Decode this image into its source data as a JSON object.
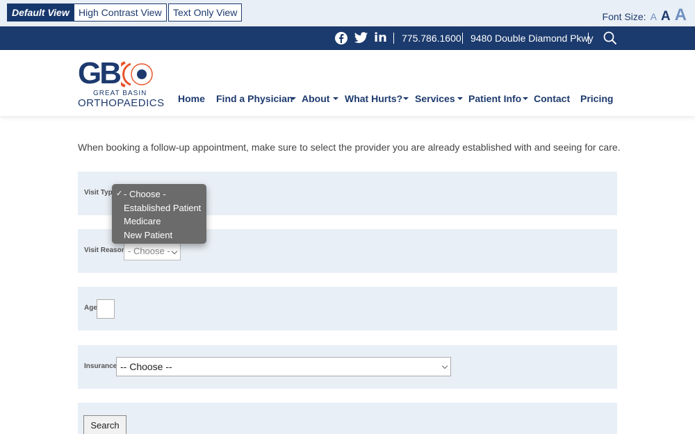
{
  "accessibility": {
    "views": [
      {
        "label": "Default View",
        "active": true
      },
      {
        "label": "High Contrast View",
        "active": false
      },
      {
        "label": "Text Only View",
        "active": false
      }
    ],
    "font_size_label": "Font Size:",
    "font_size_options": [
      "A",
      "A",
      "A"
    ]
  },
  "topbar": {
    "phone": "775.786.1600",
    "address": "9480 Double Diamond Pkwy",
    "social": [
      "facebook-icon",
      "twitter-icon",
      "linkedin-icon"
    ],
    "search_icon": "search-icon"
  },
  "logo": {
    "mark": "GB",
    "line1": "GREAT BASIN",
    "line2": "ORTHOPAEDICS"
  },
  "nav": {
    "items": [
      {
        "label": "Home",
        "has_dropdown": false
      },
      {
        "label": "Find a Physician",
        "has_dropdown": true
      },
      {
        "label": "About",
        "has_dropdown": true
      },
      {
        "label": "What Hurts?",
        "has_dropdown": true
      },
      {
        "label": "Services",
        "has_dropdown": true
      },
      {
        "label": "Patient Info",
        "has_dropdown": true
      },
      {
        "label": "Contact",
        "has_dropdown": false
      },
      {
        "label": "Pricing",
        "has_dropdown": false
      }
    ]
  },
  "content": {
    "intro": "When booking a follow-up appointment, make sure to select the provider you are already established with and seeing for care."
  },
  "form": {
    "visit_type": {
      "label": "Visit Type",
      "options": [
        "- Choose -",
        "Established Patient",
        "Medicare",
        "New Patient"
      ],
      "selected": "- Choose -"
    },
    "visit_reason": {
      "label": "Visit Reason",
      "value": "- Choose -"
    },
    "age": {
      "label": "Age",
      "value": ""
    },
    "insurance": {
      "label": "Insurance",
      "value": "-- Choose --"
    },
    "search_label": "Search"
  },
  "colors": {
    "brand_navy": "#1b3a6d",
    "accent_orange": "#e8552b",
    "panel_bg": "#e9eff6"
  }
}
